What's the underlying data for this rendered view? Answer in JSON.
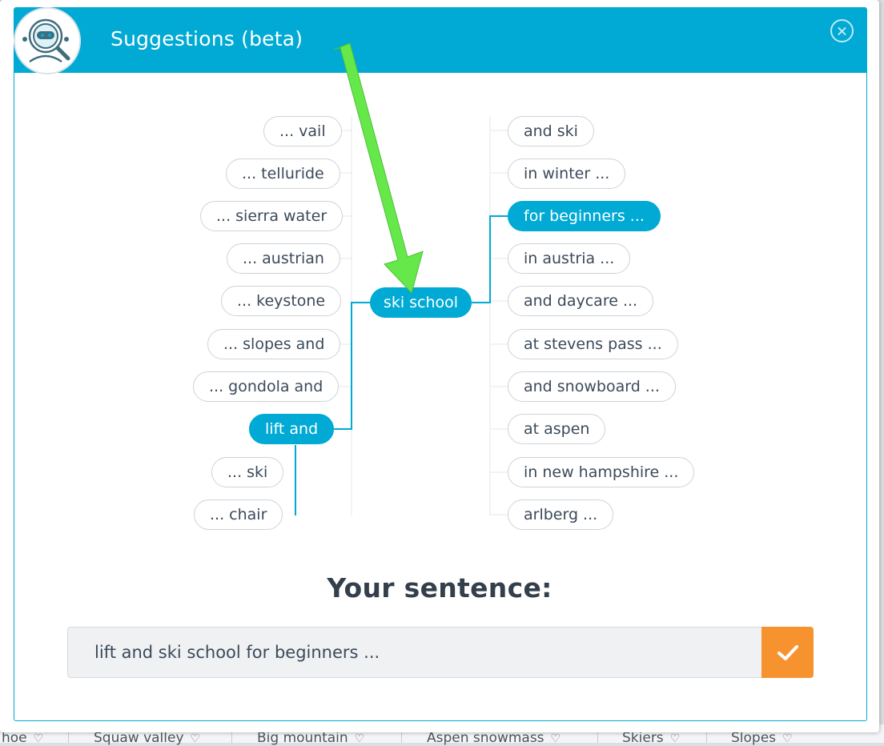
{
  "modal": {
    "title": "Suggestions (beta)",
    "accent_color": "#00aad4",
    "confirm_color": "#f7932f",
    "highlight_arrow_color": "#66e84a"
  },
  "center_word": "ski school",
  "left_suggestions": [
    "... vail",
    "... telluride",
    "... sierra water",
    "... austrian",
    "... keystone",
    "... slopes and",
    "... gondola and",
    "lift and"
  ],
  "left_sub_suggestions": [
    "... ski",
    "... chair"
  ],
  "right_suggestions": [
    "and ski",
    "in winter ...",
    "for beginners ...",
    "in austria ...",
    "and daycare ...",
    "at stevens pass ...",
    "and snowboard ...",
    "at aspen",
    "in new hampshire ...",
    "arlberg ..."
  ],
  "selected": {
    "left": "lift and",
    "right": "for beginners ..."
  },
  "sentence": {
    "heading": "Your sentence:",
    "value": "lift and ski school for beginners ..."
  },
  "background_tags": [
    "hoe",
    "Squaw valley",
    "Big mountain",
    "Aspen snowmass",
    "Skiers",
    "Slopes"
  ]
}
